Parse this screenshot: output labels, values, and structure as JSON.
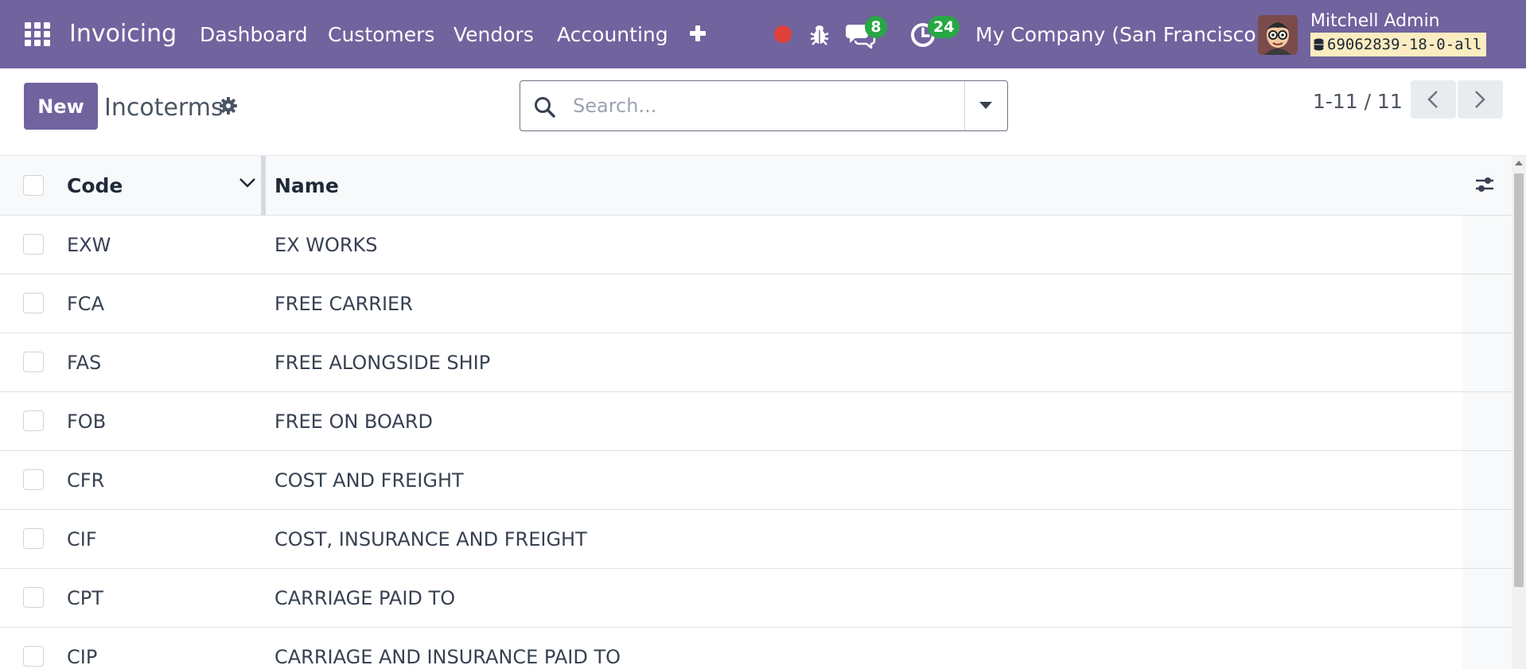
{
  "navbar": {
    "app_name": "Invoicing",
    "menu": [
      "Dashboard",
      "Customers",
      "Vendors",
      "Accounting"
    ],
    "messages_count": "8",
    "activities_count": "24",
    "company": "My Company (San Francisco)",
    "user_name": "Mitchell Admin",
    "database": "69062839-18-0-all",
    "brand_color": "#71639e"
  },
  "control_panel": {
    "new_label": "New",
    "title": "Incoterms",
    "search_placeholder": "Search...",
    "pager": "1-11 / 11"
  },
  "list": {
    "columns": [
      "Code",
      "Name"
    ],
    "rows": [
      {
        "code": "EXW",
        "name": "EX WORKS"
      },
      {
        "code": "FCA",
        "name": "FREE CARRIER"
      },
      {
        "code": "FAS",
        "name": "FREE ALONGSIDE SHIP"
      },
      {
        "code": "FOB",
        "name": "FREE ON BOARD"
      },
      {
        "code": "CFR",
        "name": "COST AND FREIGHT"
      },
      {
        "code": "CIF",
        "name": "COST, INSURANCE AND FREIGHT"
      },
      {
        "code": "CPT",
        "name": "CARRIAGE PAID TO"
      },
      {
        "code": "CIP",
        "name": "CARRIAGE AND INSURANCE PAID TO"
      }
    ]
  },
  "icons": [
    "apps-menu-icon",
    "plus-icon",
    "record-icon",
    "bug-icon",
    "chat-icon",
    "activity-clock-icon",
    "database-icon",
    "gear-icon",
    "search-icon",
    "caret-down-icon",
    "chevron-left-icon",
    "chevron-right-icon",
    "sort-chevron-down-icon",
    "sliders-icon"
  ]
}
